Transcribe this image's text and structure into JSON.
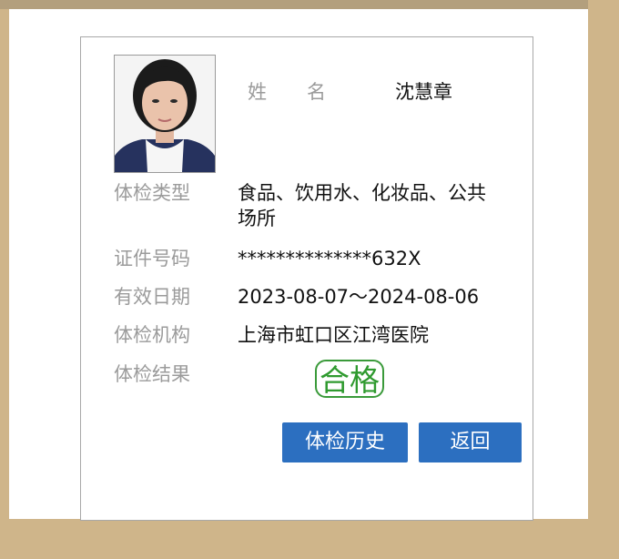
{
  "profile": {
    "name_label_chars": [
      "姓",
      "名"
    ],
    "name_value": "沈慧章"
  },
  "fields": {
    "exam_type_label": "体检类型",
    "exam_type_value": "食品、饮用水、化妆品、公共场所",
    "id_label": "证件号码",
    "id_value": "**************632X",
    "validity_label": "有效日期",
    "validity_value": "2023-08-07～2024-08-06",
    "institution_label": "体检机构",
    "institution_value": "上海市虹口区江湾医院",
    "result_label": "体检结果",
    "result_value": "合格"
  },
  "buttons": {
    "history_label": "体检历史",
    "back_label": "返回"
  },
  "colors": {
    "button_blue": "#2c6fc0",
    "pass_green": "#2f9a2f",
    "frame_tan": "#cfb58a"
  }
}
